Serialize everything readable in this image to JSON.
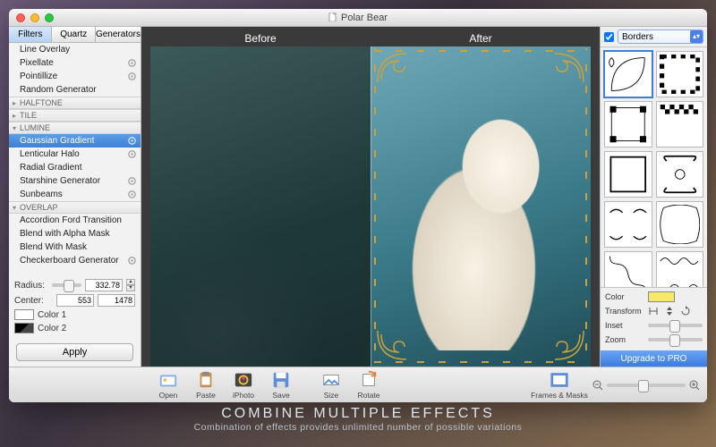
{
  "window": {
    "title": "Polar Bear"
  },
  "tabs": {
    "items": [
      "Filters",
      "Quartz",
      "Generators"
    ],
    "selected": 0
  },
  "list": {
    "top_items": [
      {
        "label": "Line Overlay",
        "gear": false
      },
      {
        "label": "Pixellate",
        "gear": true
      },
      {
        "label": "Pointillize",
        "gear": true
      },
      {
        "label": "Random Generator",
        "gear": false
      }
    ],
    "groups": [
      {
        "name": "HALFTONE",
        "open": false
      },
      {
        "name": "TILE",
        "open": false
      },
      {
        "name": "LUMINE",
        "open": true,
        "items": [
          {
            "label": "Gaussian Gradient",
            "gear": true,
            "selected": true
          },
          {
            "label": "Lenticular Halo",
            "gear": true
          },
          {
            "label": "Radial Gradient",
            "gear": false
          },
          {
            "label": "Starshine Generator",
            "gear": true
          },
          {
            "label": "Sunbeams",
            "gear": true
          }
        ]
      },
      {
        "name": "OVERLAP",
        "open": true,
        "items": [
          {
            "label": "Accordion Ford Transition",
            "gear": false
          },
          {
            "label": "Blend with Alpha Mask",
            "gear": false
          },
          {
            "label": "Blend With Mask",
            "gear": false
          },
          {
            "label": "Checkerboard Generator",
            "gear": true
          }
        ]
      }
    ]
  },
  "params": {
    "radius_label": "Radius:",
    "radius_value": "332.78",
    "center_label": "Center:",
    "center_x": "553",
    "center_y": "1478",
    "color1_label": "Color 1",
    "color2_label": "Color 2",
    "color1": "#ffffff",
    "color2": "#000000"
  },
  "apply_label": "Apply",
  "canvas": {
    "before_label": "Before",
    "after_label": "After"
  },
  "right": {
    "checked": true,
    "select_label": "Borders",
    "color_label": "Color",
    "color_value": "#f6e96a",
    "transform_label": "Transform",
    "inset_label": "Inset",
    "zoom_label": "Zoom",
    "upgrade_label": "Upgrade to PRO"
  },
  "bottom": {
    "buttons": [
      {
        "label": "Open"
      },
      {
        "label": "Paste"
      },
      {
        "label": "iPhoto"
      },
      {
        "label": "Save"
      },
      {
        "label": "Size"
      },
      {
        "label": "Rotate"
      }
    ],
    "frames_label": "Frames & Masks"
  },
  "promo": {
    "headline": "COMBINE MULTIPLE EFFECTS",
    "sub": "Combination of effects provides unlimited number of possible variations"
  }
}
